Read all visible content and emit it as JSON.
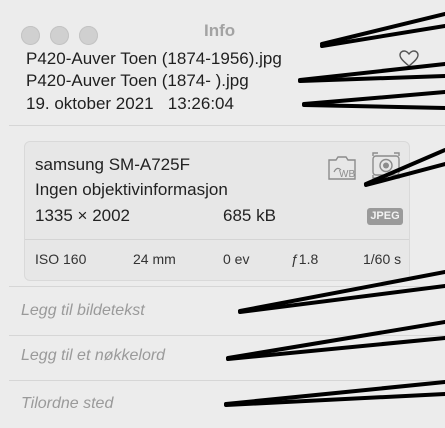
{
  "window": {
    "title": "Info"
  },
  "file": {
    "name_full": "P420-Auver Toen (1874-1956).jpg",
    "name_alt": "P420-Auver Toen (1874- ).jpg",
    "date": "19. oktober 2021",
    "time": "13:26:04"
  },
  "camera": {
    "model": "samsung SM-A725F",
    "lens": "Ingen objektivinformasjon",
    "dimensions": "1335 × 2002",
    "filesize": "685 kB",
    "format": "JPEG",
    "wb_label": "WB"
  },
  "exif": {
    "iso": "ISO 160",
    "focal": "24 mm",
    "ev": "0 ev",
    "aperture": "ƒ1.8",
    "shutter": "1/60 s"
  },
  "fields": {
    "caption_placeholder": "Legg til bildetekst",
    "keyword_placeholder": "Legg til et nøkkelord",
    "location_placeholder": "Tilordne sted"
  },
  "colors": {
    "panel_bg": "#ececec",
    "annotation_line": "#000000"
  },
  "icons": [
    "heart-icon",
    "camera-wb-icon",
    "metering-icon"
  ]
}
